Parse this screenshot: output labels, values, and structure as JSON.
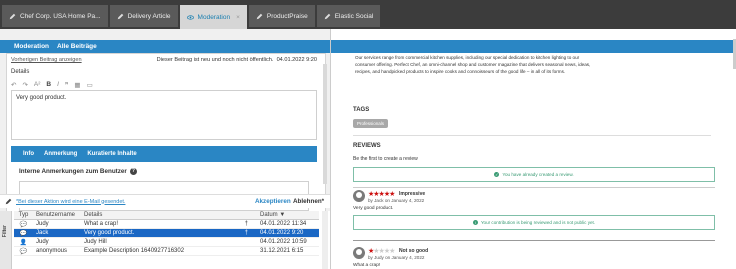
{
  "tabs": [
    {
      "label": "Chef Corp. USA Home Pa...",
      "active": false
    },
    {
      "label": "Delivery Article",
      "active": false
    },
    {
      "label": "Moderation",
      "active": true,
      "close": "×"
    },
    {
      "label": "ProductPraise",
      "active": false
    },
    {
      "label": "Elastic Social",
      "active": false
    }
  ],
  "moderation": {
    "tab_moderation": "Moderation",
    "tab_all": "Alle Beiträge",
    "prev_link": "Vorherigen Beitrag anzeigen",
    "status_text": "Dieser Beitrag ist neu und noch nicht öffentlich.",
    "status_date": "04.01.2022 9:20",
    "details_label": "Details",
    "editor_text": "Very good product.",
    "subtabs": [
      "Info",
      "Anmerkung",
      "Kuratierte Inhalte"
    ],
    "notes_label": "Interne Anmerkungen zum Benutzer",
    "help": "?",
    "email_note": "*Bei dieser Aktion wird eine E-Mail gesendet.",
    "accept": "Akzeptieren",
    "reject": "Ablehnen*"
  },
  "grid": {
    "filter_label": "Filter",
    "headers": {
      "typ": "Typ",
      "user": "Benutzername",
      "details": "Details",
      "date": "Datum ▼"
    },
    "rows": [
      {
        "user": "Judy",
        "details": "What a crap!",
        "flag": "†",
        "date": "04.01.2022 11:34",
        "selected": false
      },
      {
        "user": "Jack",
        "details": "Very good product.",
        "flag": "†",
        "date": "04.01.2022 9:20",
        "selected": true
      },
      {
        "user": "Judy",
        "details": "Judy Hill",
        "flag": "",
        "date": "04.01.2022 10:59",
        "selected": false
      },
      {
        "user": "anonymous",
        "details": "Example Description 1640927716302",
        "flag": "",
        "date": "31.12.2021 6:15",
        "selected": false
      }
    ]
  },
  "preview": {
    "intro": "Our services range from commercial kitchen supplies, including our special dedication to kitchen lighting to our consumer offering. Perfect Chef, an omni-channel shop and customer magazine that delivers seasonal news, ideas, recipes, and handpicked products to inspire cooks and connoisseurs of the good life – in all of its forms.",
    "tags_heading": "TAGS",
    "tag": "Professionals",
    "reviews_heading": "REVIEWS",
    "first_review": "Be the first to create a review",
    "already_created": "You have already created a review.",
    "review1": {
      "title": "Impressive",
      "by": "by Jack on January 4, 2022",
      "text": "Very good product.",
      "rating": 5
    },
    "pending": "Your contribution is being reviewed and is not public yet.",
    "review2": {
      "title": "Not so good",
      "by": "by Judy on January 4, 2022",
      "text": "What a crap!",
      "rating": 1
    }
  }
}
